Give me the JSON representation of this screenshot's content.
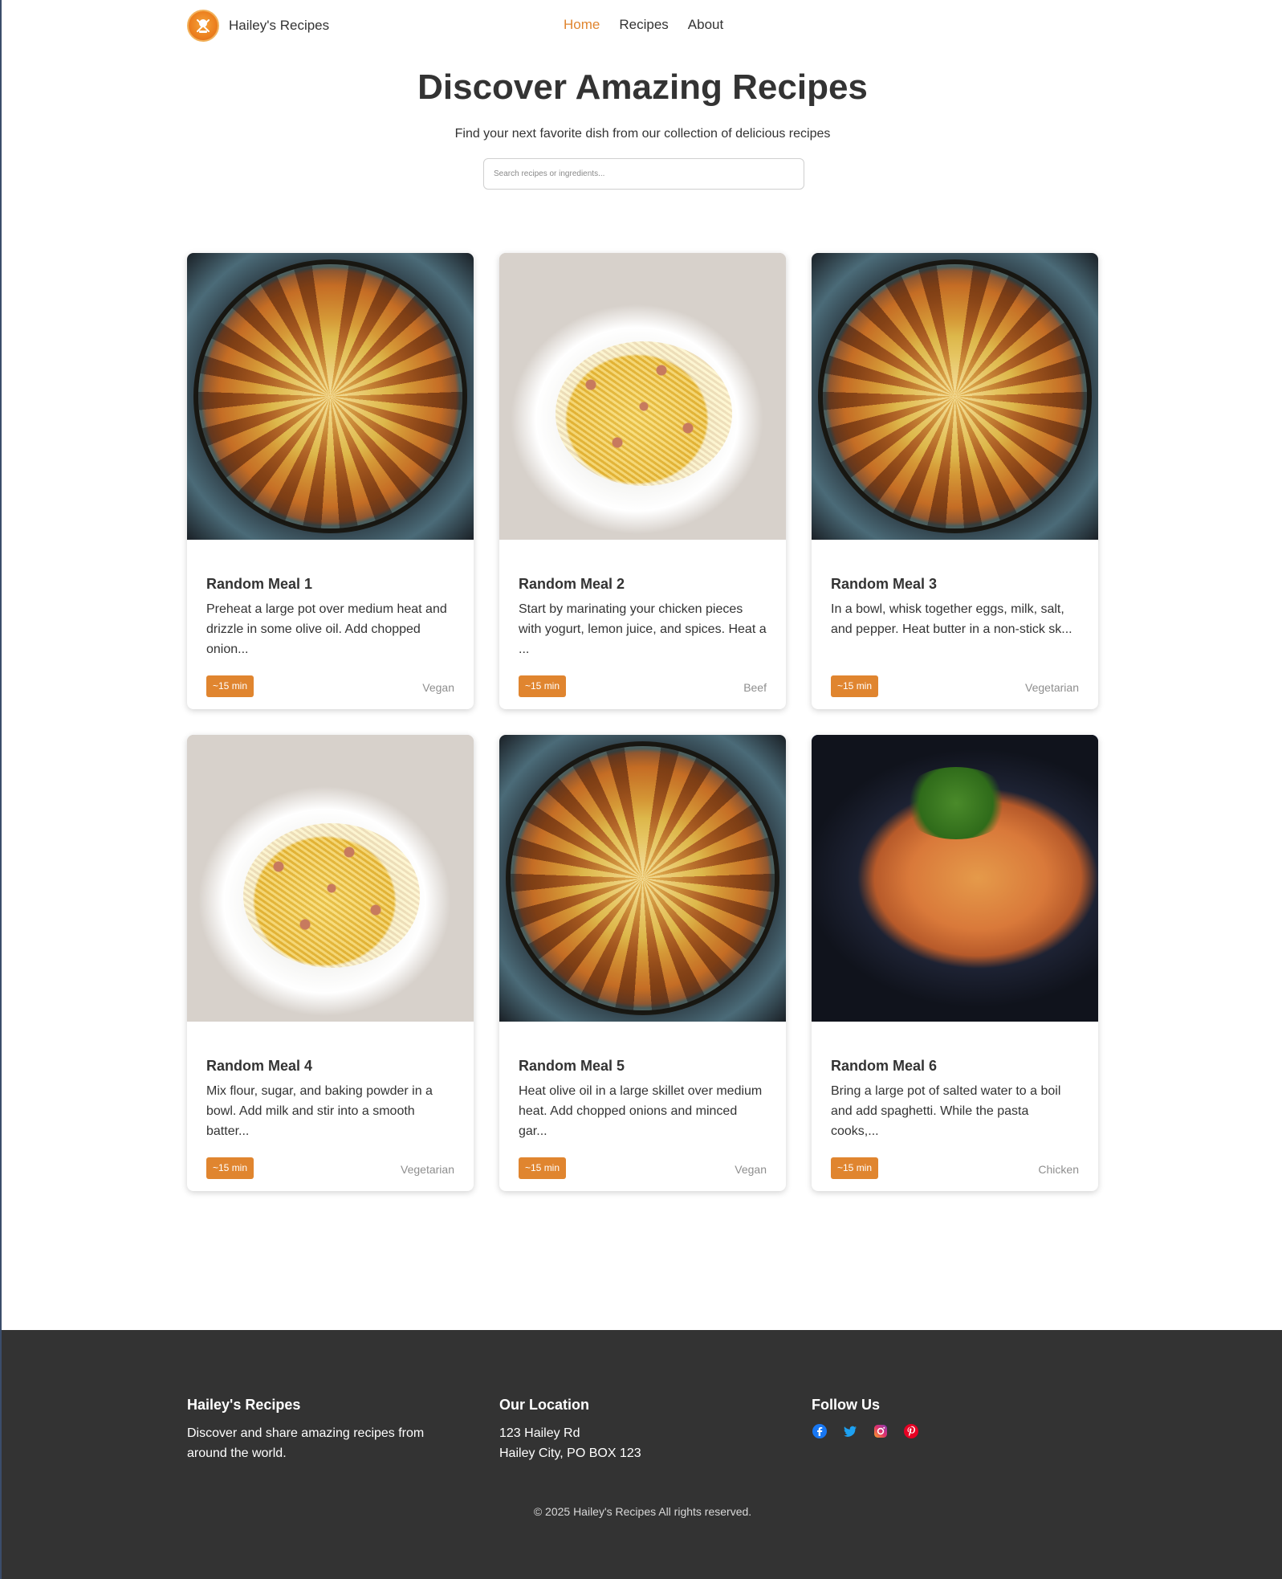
{
  "header": {
    "brand": "Hailey's Recipes",
    "nav": [
      {
        "label": "Home",
        "active": true
      },
      {
        "label": "Recipes",
        "active": false
      },
      {
        "label": "About",
        "active": false
      }
    ]
  },
  "hero": {
    "title": "Discover Amazing Recipes",
    "subtitle": "Find your next favorite dish from our collection of delicious recipes",
    "search_placeholder": "Search recipes or ingredients..."
  },
  "recipes": [
    {
      "title": "Random Meal 1",
      "description": "Preheat a large pot over medium heat and drizzle in some olive oil. Add chopped onion...",
      "time": "~15 min",
      "category": "Vegan",
      "image": "apple-tart"
    },
    {
      "title": "Random Meal 2",
      "description": "Start by marinating your chicken pieces with yogurt, lemon juice, and spices. Heat a ...",
      "time": "~15 min",
      "category": "Beef",
      "image": "spaghetti-carbonara"
    },
    {
      "title": "Random Meal 3",
      "description": "In a bowl, whisk together eggs, milk, salt, and pepper. Heat butter in a non-stick sk...",
      "time": "~15 min",
      "category": "Vegetarian",
      "image": "apple-tart"
    },
    {
      "title": "Random Meal 4",
      "description": "Mix flour, sugar, and baking powder in a bowl. Add milk and stir into a smooth batter...",
      "time": "~15 min",
      "category": "Vegetarian",
      "image": "spaghetti-carbonara"
    },
    {
      "title": "Random Meal 5",
      "description": "Heat olive oil in a large skillet over medium heat. Add chopped onions and minced gar...",
      "time": "~15 min",
      "category": "Vegan",
      "image": "apple-tart"
    },
    {
      "title": "Random Meal 6",
      "description": "Bring a large pot of salted water to a boil and add spaghetti. While the pasta cooks,...",
      "time": "~15 min",
      "category": "Chicken",
      "image": "penne-pasta"
    }
  ],
  "footer": {
    "about_title": "Hailey's Recipes",
    "about_text": "Discover and share amazing recipes from around the world.",
    "location_title": "Our Location",
    "address_line1": "123 Hailey Rd",
    "address_line2": "Hailey City, PO BOX 123",
    "follow_title": "Follow Us",
    "social_icons": [
      "facebook-icon",
      "twitter-icon",
      "instagram-icon",
      "pinterest-icon"
    ],
    "copyright": "© 2025 Hailey's Recipes All rights reserved."
  },
  "colors": {
    "accent": "#e0852f",
    "text": "#333333",
    "footer_bg": "#333333",
    "muted": "#8e8e8e"
  }
}
